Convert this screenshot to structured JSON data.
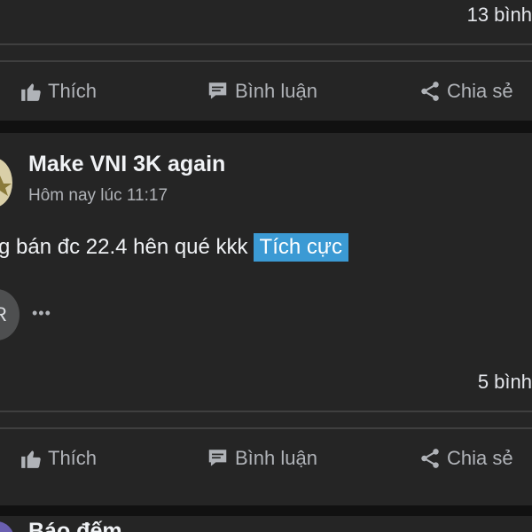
{
  "post1": {
    "comment_count": "13 bình",
    "actions": {
      "like": "Thích",
      "comment": "Bình luận",
      "share": "Chia sẻ"
    }
  },
  "post2": {
    "author": "Make VNI 3K again",
    "time": "Hôm nay lúc 11:17",
    "body": "g bán đc 22.4 hên qué kkk",
    "highlight": "Tích cực",
    "reaction_avatar_initial": "R",
    "more": "•••",
    "comment_count": "5 bình",
    "actions": {
      "like": "Thích",
      "comment": "Bình luận",
      "share": "Chia sẻ"
    }
  },
  "post3": {
    "author": "Báo đếm"
  },
  "icons": {
    "like": "thumbs-up-icon",
    "comment": "comment-bubble-icon",
    "share": "share-icon"
  },
  "colors": {
    "background": "#111111",
    "card": "#252525",
    "divider": "#3f3f3f",
    "highlight": "#3b9ad4",
    "secondary_text": "#b0b3b8"
  }
}
